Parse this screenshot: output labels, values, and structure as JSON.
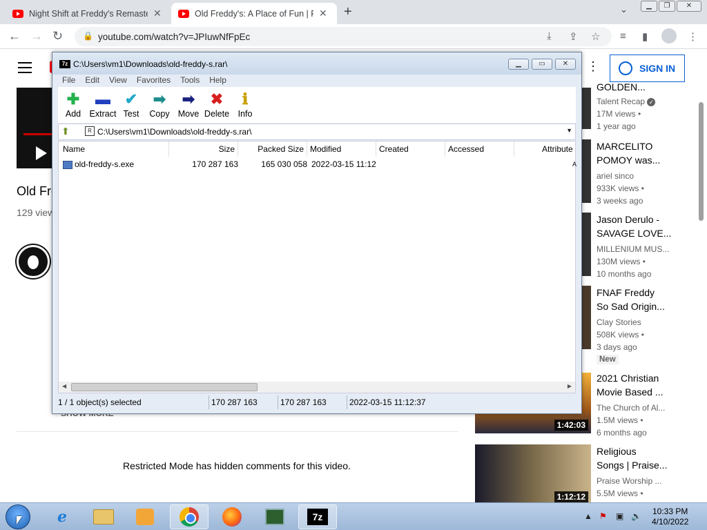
{
  "browser": {
    "tabs": [
      {
        "title": "Night Shift at Freddy's Remastered",
        "active": false
      },
      {
        "title": "Old Freddy's: A Place of Fun | PC",
        "active": true
      }
    ],
    "new_tab": "+",
    "url": "youtube.com/watch?v=JPIuwNfFpEc"
  },
  "youtube": {
    "sign_in": "SIGN IN",
    "video_title": "Old Fre",
    "views": "129 view",
    "show_more": "SHOW MORE",
    "restricted_text": "Restricted Mode has hidden comments for this video.",
    "recommendations": [
      {
        "title_line1": "GOLDEN...",
        "title_line2": "",
        "channel": "Talent Recap",
        "views": "17M views •",
        "age": "1 year ago",
        "badge": ""
      },
      {
        "title_line1": "MARCELITO",
        "title_line2": "POMOY was...",
        "channel": "ariel sinco",
        "views": "933K views •",
        "age": "3 weeks ago",
        "badge": ""
      },
      {
        "title_line1": "Jason Derulo -",
        "title_line2": "SAVAGE LOVE...",
        "channel": "MILLENIUM MUS...",
        "views": "130M views •",
        "age": "10 months ago",
        "badge": ""
      },
      {
        "title_line1": "FNAF Freddy",
        "title_line2": "So Sad Origin...",
        "channel": "Clay Stories",
        "views": "508K views •",
        "age": "3 days ago",
        "badge": "New"
      },
      {
        "title_line1": "2021 Christian",
        "title_line2": "Movie Based ...",
        "channel": "The Church of Al...",
        "views": "1.5M views •",
        "age": "6 months ago",
        "badge": "",
        "duration": "1:42:03"
      },
      {
        "title_line1": "Religious",
        "title_line2": "Songs | Praise...",
        "channel": "Praise Worship ...",
        "views": "5.5M views •",
        "age": "",
        "badge": "",
        "duration": "1:12:12"
      }
    ]
  },
  "sevenzip": {
    "title": "C:\\Users\\vm1\\Downloads\\old-freddy-s.rar\\",
    "menu": [
      "File",
      "Edit",
      "View",
      "Favorites",
      "Tools",
      "Help"
    ],
    "tools": [
      {
        "label": "Add",
        "glyph": "✚",
        "color": "#22b14c"
      },
      {
        "label": "Extract",
        "glyph": "▬",
        "color": "#1f3fbf"
      },
      {
        "label": "Test",
        "glyph": "✔",
        "color": "#1fa8c9"
      },
      {
        "label": "Copy",
        "glyph": "➡",
        "color": "#1e8c8c"
      },
      {
        "label": "Move",
        "glyph": "➡",
        "color": "#1a237e"
      },
      {
        "label": "Delete",
        "glyph": "✖",
        "color": "#d81e1e"
      },
      {
        "label": "Info",
        "glyph": "ℹ",
        "color": "#c8a000"
      }
    ],
    "address": "C:\\Users\\vm1\\Downloads\\old-freddy-s.rar\\",
    "columns": [
      "Name",
      "Size",
      "Packed Size",
      "Modified",
      "Created",
      "Accessed",
      "Attribute"
    ],
    "rows": [
      {
        "name": "old-freddy-s.exe",
        "size": "170 287 163",
        "packed": "165 030 058",
        "modified": "2022-03-15 11:12",
        "created": "",
        "accessed": "",
        "attr": "A"
      }
    ],
    "status": {
      "selected": "1 / 1 object(s) selected",
      "size": "170 287 163",
      "packed": "170 287 163",
      "modified": "2022-03-15 11:12:37"
    }
  },
  "taskbar": {
    "time": "10:33 PM",
    "date": "4/10/2022"
  }
}
